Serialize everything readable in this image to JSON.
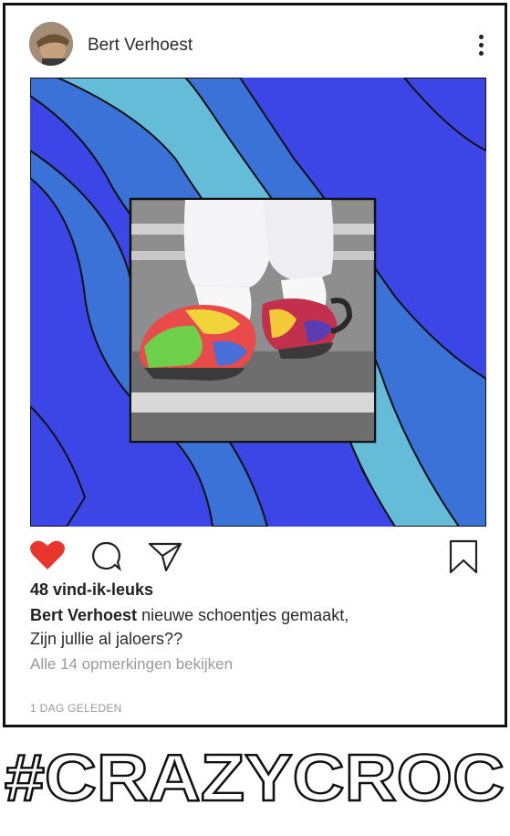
{
  "post": {
    "username": "Bert Verhoest",
    "likes": "48 vind-ik-leuks",
    "caption_user": "Bert Verhoest",
    "caption_line1": "nieuwe schoentjes gemaakt,",
    "caption_line2": "Zijn jullie al jaloers??",
    "view_comments": "Alle 14 opmerkingen bekijken",
    "timestamp": "1 DAG GELEDEN"
  },
  "icons": {
    "more": "more-vertical-icon",
    "like": "heart-icon",
    "comment": "comment-icon",
    "share": "paper-plane-icon",
    "save": "bookmark-icon"
  },
  "colors": {
    "heart": "#e8362c",
    "wave_dark": "#3c46e6",
    "wave_mid": "#3a72d8",
    "wave_light": "#64bcd9"
  },
  "hashtag": "#CRAZYCROC"
}
